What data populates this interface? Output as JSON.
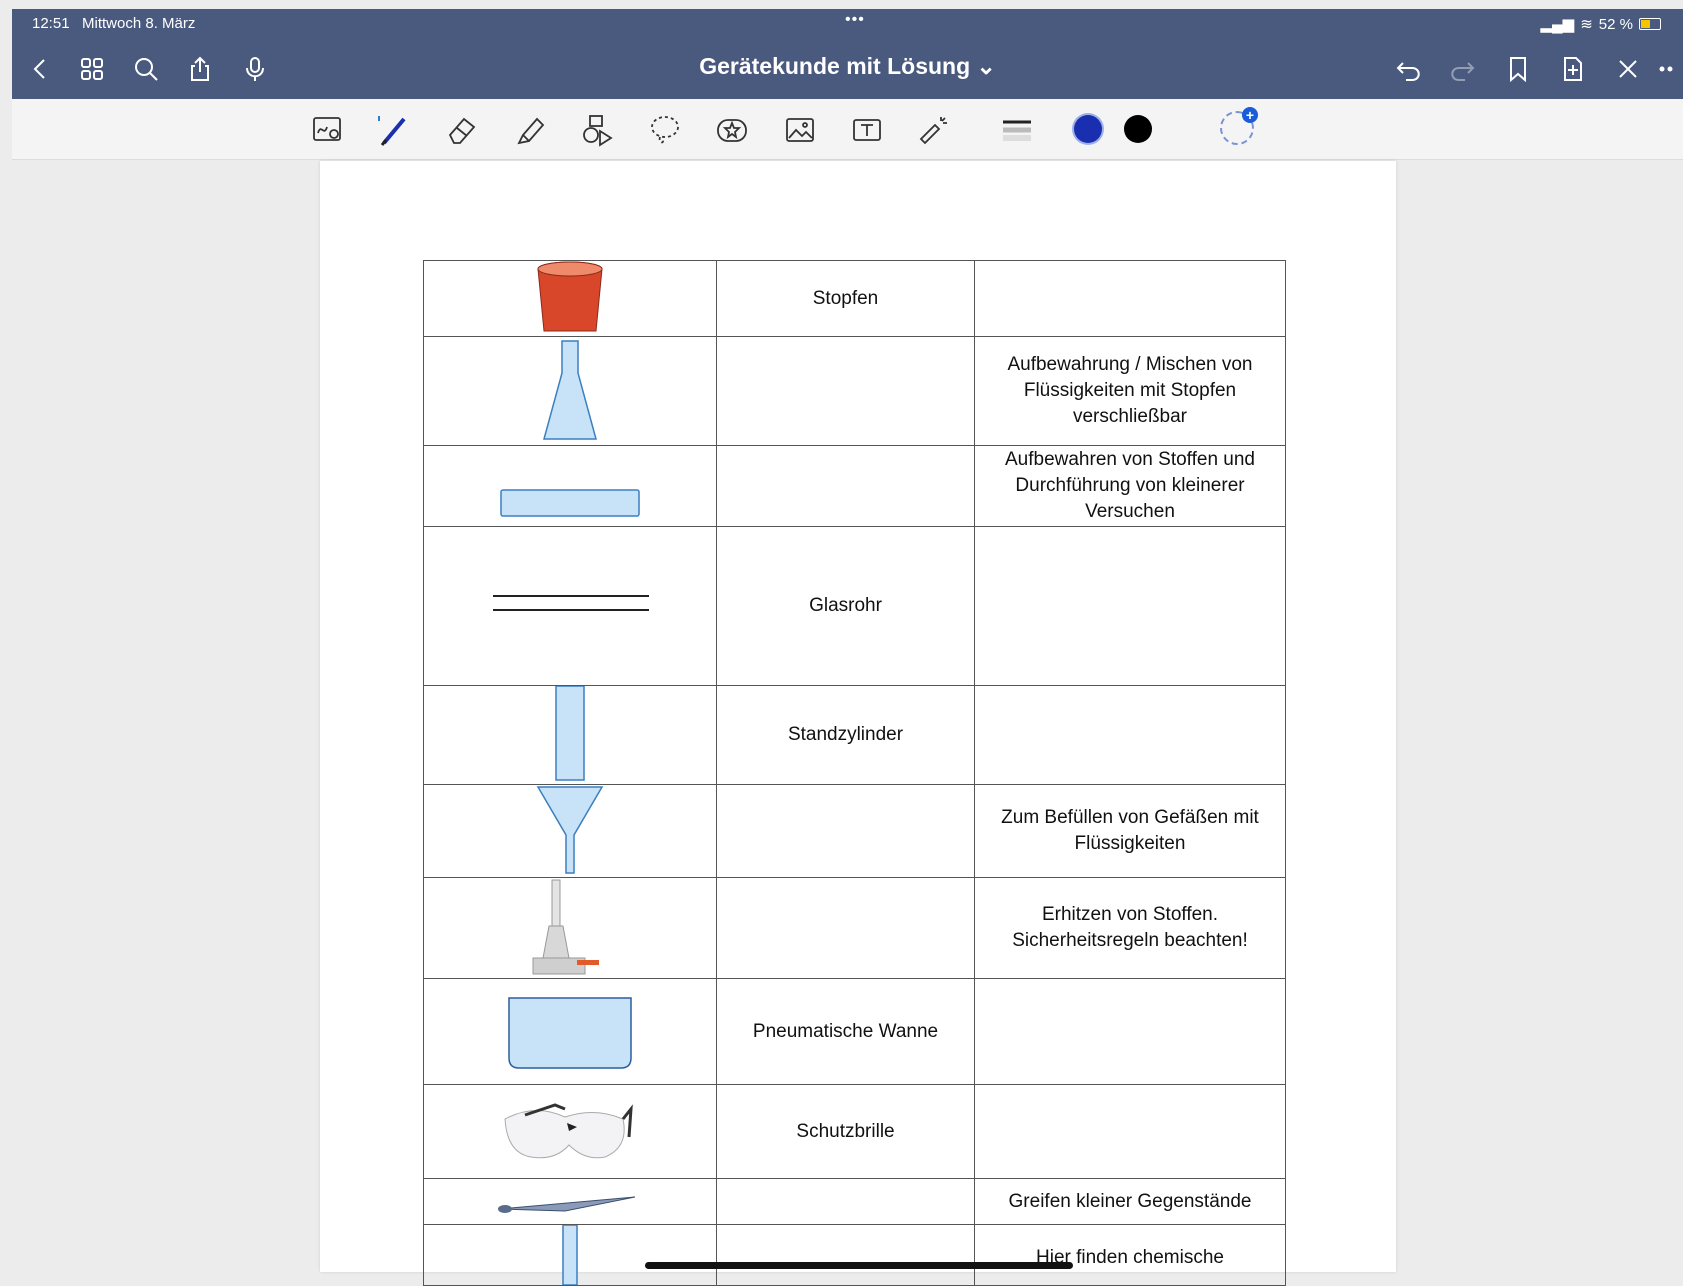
{
  "status_bar": {
    "time": "12:51",
    "date": "Mittwoch 8. März",
    "battery": "52 %"
  },
  "header": {
    "title": "Gerätekunde mit Lösung ⌄",
    "more": "•••"
  },
  "header_icons": [
    "back-icon",
    "grid-icon",
    "search-icon",
    "share-icon",
    "microphone-icon",
    "undo-icon",
    "redo-icon",
    "bookmark-icon",
    "add-page-icon",
    "close-icon",
    "more-icon"
  ],
  "toolbar": {
    "tools": [
      "zoom-write-icon",
      "pen-icon",
      "eraser-icon",
      "highlighter-icon",
      "shapes-icon",
      "lasso-icon",
      "sticker-icon",
      "image-icon",
      "textbox-icon",
      "laser-pointer-icon",
      "stroke-width-icon"
    ],
    "colors": {
      "selected": "#1a2fb0",
      "second": "#000000"
    }
  },
  "table": {
    "rows": [
      {
        "image": "stopper",
        "name": "Stopfen",
        "use": ""
      },
      {
        "image": "erlenmeyer-flask",
        "name": "",
        "use": "Aufbewahrung / Mischen von Flüssigkeiten mit Stopfen verschließbar"
      },
      {
        "image": "petri-dish",
        "name": "",
        "use": "Aufbewahren von Stoffen und Durchführung von kleinerer Versuchen"
      },
      {
        "image": "glass-tube",
        "name": "Glasrohr",
        "use": ""
      },
      {
        "image": "standing-cylinder",
        "name": "Standzylinder",
        "use": ""
      },
      {
        "image": "funnel",
        "name": "",
        "use": "Zum Befüllen von Gefäßen mit Flüssigkeiten"
      },
      {
        "image": "bunsen-burner",
        "name": "",
        "use": "Erhitzen von Stoffen. Sicherheitsregeln beachten!"
      },
      {
        "image": "pneumatic-trough",
        "name": "Pneumatische Wanne",
        "use": ""
      },
      {
        "image": "safety-goggles",
        "name": "Schutzbrille",
        "use": ""
      },
      {
        "image": "tweezers",
        "name": "",
        "use": "Greifen kleiner Gegenstände"
      },
      {
        "image": "test-tube",
        "name": "",
        "use": "Hier finden chemische"
      }
    ]
  }
}
